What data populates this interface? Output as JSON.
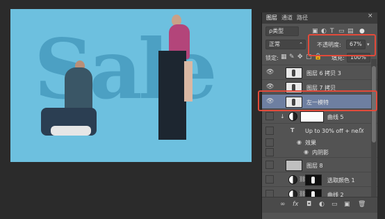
{
  "canvas": {
    "sale_text": [
      "S",
      "a",
      "l",
      "e"
    ]
  },
  "panel": {
    "tabs": [
      "图层",
      "通道",
      "路径"
    ],
    "close_icon": "×",
    "filter_type": "ρ类型",
    "blend_mode": "正常",
    "opacity_label": "不透明度:",
    "opacity_value": "67%",
    "lock_label": "锁定:",
    "fill_label": "填充:",
    "fill_value": "100%",
    "layers": [
      {
        "name": "图层 6 拷贝 3",
        "visible": true
      },
      {
        "name": "图层 7 拷贝",
        "visible": true
      },
      {
        "name": "左一模特",
        "visible": true,
        "selected": true
      },
      {
        "name": "曲线 5",
        "visible": false
      },
      {
        "name": "Up to 30% off + ne...",
        "visible": false,
        "type": "T",
        "fx": "fx"
      },
      {
        "name": "效果",
        "visible": false
      },
      {
        "name": "内阴影",
        "visible": false
      },
      {
        "name": "图层 8",
        "visible": false
      },
      {
        "name": "选取颜色 1",
        "visible": false
      },
      {
        "name": "曲线 2",
        "visible": false
      }
    ],
    "bottom_icons": [
      "∞",
      "fx",
      "◘",
      "◐",
      "▭",
      "▣",
      "🗑"
    ]
  },
  "colors": {
    "accent_highlight": "#e24a3a",
    "selected_layer": "#6e7fa1",
    "canvas_bg": "#6dc0df"
  }
}
